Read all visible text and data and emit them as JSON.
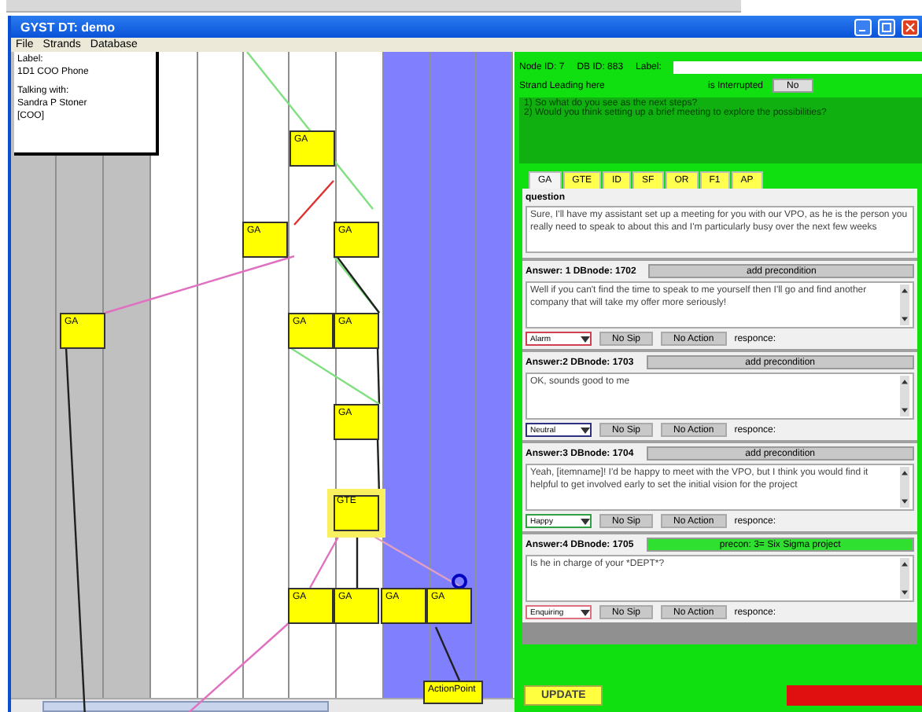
{
  "window": {
    "title": "GYST DT: demo"
  },
  "menu": [
    "File",
    "Strands",
    "Database"
  ],
  "label_box": [
    "Label:",
    "1D1 COO Phone",
    "Talking with:",
    "Sandra P Stoner",
    "[COO]"
  ],
  "nodes": [
    {
      "label": "GA",
      "selected": false
    },
    {
      "label": "GA",
      "selected": false
    },
    {
      "label": "GA",
      "selected": false
    },
    {
      "label": "GA",
      "selected": false
    },
    {
      "label": "GA",
      "selected": false
    },
    {
      "label": "GA",
      "selected": false
    },
    {
      "label": "GA",
      "selected": false
    },
    {
      "label": "GTE",
      "selected": true
    },
    {
      "label": "GA",
      "selected": false
    },
    {
      "label": "GA",
      "selected": false
    },
    {
      "label": "GA",
      "selected": false
    },
    {
      "label": "GA",
      "selected": false
    },
    {
      "label": "ActionPoint",
      "selected": false
    }
  ],
  "details": {
    "node_id": "Node ID: 7",
    "db_id": "DB ID: 883",
    "label_caption": "Label:",
    "strand": "Strand Leading here",
    "interrupted_caption": "is Interrupted",
    "interrupted_value": "No",
    "prompts": [
      "1) So what do you see as the next steps?",
      "2) Would you think setting up a brief meeting to explore the possibilities?"
    ]
  },
  "tabs": [
    {
      "label": "GA",
      "selected": true
    },
    {
      "label": "GTE",
      "selected": false
    },
    {
      "label": "ID",
      "selected": false
    },
    {
      "label": "SF",
      "selected": false
    },
    {
      "label": "OR",
      "selected": false
    },
    {
      "label": "F1",
      "selected": false
    },
    {
      "label": "AP",
      "selected": false
    }
  ],
  "question": {
    "caption": "question",
    "text": "Sure, I'll have my assistant set up a meeting for you with our VPO, as he is the person you really need to speak to about this and I'm particularly busy over the next few weeks"
  },
  "answers": [
    {
      "header": "Answer: 1 DBnode: 1702",
      "precondition": {
        "label": "add precondition",
        "set": false
      },
      "text": "Well if you can't find the time to speak to me yourself then I'll go and find another company that will take my offer more seriously!",
      "emotion": "Alarm",
      "color": "#d04050",
      "slip": "No Sip",
      "action": "No Action",
      "response": "responce:"
    },
    {
      "header": "Answer:2 DBnode: 1703",
      "precondition": {
        "label": "add precondition",
        "set": false
      },
      "text": "OK, sounds good to me",
      "emotion": "Neutral",
      "color": "#303080",
      "slip": "No Sip",
      "action": "No Action",
      "response": "responce:"
    },
    {
      "header": "Answer:3 DBnode: 1704",
      "precondition": {
        "label": "add precondition",
        "set": false
      },
      "text": "Yeah, [itemname]! I'd be happy to meet with the VPO, but I think you would find it helpful to get involved early to set the initial vision for the project",
      "emotion": "Happy",
      "color": "#30a040",
      "slip": "No Sip",
      "action": "No Action",
      "response": "responce:"
    },
    {
      "header": "Answer:4 DBnode: 1705",
      "precondition": {
        "label": "precon: 3= Six Sigma project",
        "set": true
      },
      "text": "Is he in charge of your *DEPT*?",
      "emotion": "Enquiring",
      "color": "#e07080",
      "slip": "No Sip",
      "action": "No Action",
      "response": "responce:"
    }
  ],
  "buttons": {
    "update": "UPDATE"
  }
}
